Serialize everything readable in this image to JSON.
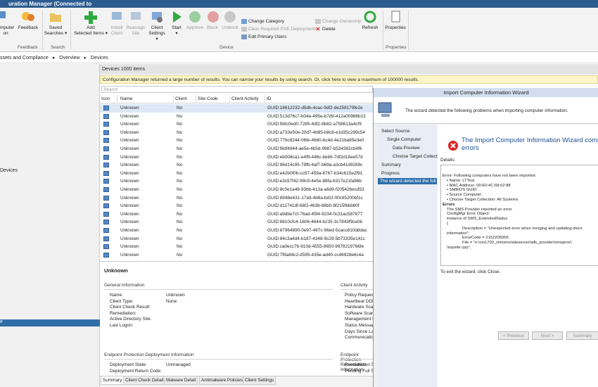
{
  "window": {
    "title": "uration Manager (Connected to"
  },
  "ribbon": {
    "buttons": [
      {
        "label": "Feedback"
      },
      {
        "label": "Saved\nSearches ▾"
      },
      {
        "label": "Add\nSelected Items ▾"
      },
      {
        "label": "Install\nClient"
      },
      {
        "label": "Reassign\nSite"
      },
      {
        "label": "Client\nSettings ▾"
      },
      {
        "label": "Start\n▾"
      },
      {
        "label": "Approve"
      },
      {
        "label": "Block"
      },
      {
        "label": "Unblock"
      },
      {
        "label": "Refresh"
      },
      {
        "label": "Properties"
      }
    ],
    "left_cut": {
      "line1": "mputer",
      "line2": "on"
    },
    "small_items": [
      {
        "label": "Change Category",
        "disabled": false
      },
      {
        "label": "Clear Required PXE Deployments",
        "disabled": true
      },
      {
        "label": "Edit Primary Users",
        "disabled": false
      },
      {
        "label": "Change Ownership",
        "disabled": true
      },
      {
        "label": "Delete",
        "disabled": false
      }
    ],
    "groups": [
      "Feedback",
      "Search",
      "Device",
      "Properties"
    ]
  },
  "address": {
    "parts": [
      "ssets and Compliance",
      "▸",
      "Overview",
      "▸",
      "Devices"
    ]
  },
  "left_pane": {
    "devices_label": "Devices",
    "bottom_label": "e"
  },
  "devices": {
    "header": "Devices 1000 items",
    "info": "Configuration Manager returned a large number of results. You can narrow your results by using search.  Or, click here to view a maximum of 100000 results.",
    "search_placeholder": "Search",
    "columns": [
      "Icon",
      "Name",
      "Client",
      "Site Code",
      "Client Activity",
      "ID"
    ],
    "rows": [
      {
        "name": "Unknown",
        "client": "No",
        "id": "GUID:18612232-d5db-4cac-9df2-de258179fe2e"
      },
      {
        "name": "Unknown",
        "client": "No",
        "id": "GUID:513d76c7-b04e-495e-b7d9-412a00988b13"
      },
      {
        "name": "Unknown",
        "client": "No",
        "id": "GUID:fb8c0ed0-7285-4df2-8b82-a758613a4cf9"
      },
      {
        "name": "Unknown",
        "client": "No",
        "id": "GUID:a733e50e-20d7-4b85-b8c8-e1d35c299c54"
      },
      {
        "name": "Unknown",
        "client": "No",
        "id": "GUID:77bc8244-06fe-4660-bc4d-4e21ba95e3e0"
      },
      {
        "name": "Unknown",
        "client": "No",
        "id": "GUID:f8df4944-ae5e-4b5d-9987-b534382cb4f6"
      },
      {
        "name": "Unknown",
        "client": "No",
        "id": "GUID:eb008ca1-e4f9-446c-beb6-7df2d18ee57d"
      },
      {
        "name": "Unknown",
        "client": "No",
        "id": "GUID:96d14c95-79fb-4af7-b69a-a3cb41d9269c"
      },
      {
        "name": "Unknown",
        "client": "No",
        "id": "GUID:e42b0f0b-cc97-459a-8767-b34c615e2f91"
      },
      {
        "name": "Unknown",
        "client": "No",
        "id": "GUID:e3c97f42-99c9-4e5e-88fa-6317e21fa96b"
      },
      {
        "name": "Unknown",
        "client": "No",
        "id": "GUID:8c0e1a48-93bb-413a-a6d9-f205426ecd53"
      },
      {
        "name": "Unknown",
        "client": "No",
        "id": "GUID:8948e431-17a9-4b6a-bd1f-00c65200bf1c"
      },
      {
        "name": "Unknown",
        "client": "No",
        "id": "GUID:d11741df-66f2-463b-86b0-8f215f6bb60f"
      },
      {
        "name": "Unknown",
        "client": "No",
        "id": "GUID:a9dbe7cf-76ad-45f4-9234-0c31ac587677"
      },
      {
        "name": "Unknown",
        "client": "No",
        "id": "GUID:8810cfc4-1606-4644-b235-3c7843f9ce0b"
      },
      {
        "name": "Unknown",
        "client": "No",
        "id": "GUID:87964890-0e97-487c-96ed-5cacc810dddac"
      },
      {
        "name": "Unknown",
        "client": "No",
        "id": "GUID:84c3a4d4-b187-4348-9c29-5b73335e141c"
      },
      {
        "name": "Unknown",
        "client": "No",
        "id": "GUID:ca0ecc76-910d-4555-9650-9978219766fe"
      },
      {
        "name": "Unknown",
        "client": "No",
        "id": "GUID:7f8a84c2-d595-435e-ad40-cc46928e6c4a"
      }
    ]
  },
  "details": {
    "title": "Unknown",
    "general_header": "General Information",
    "client_activity_header": "Client Activity",
    "general_fields": [
      {
        "label": "Name:",
        "value": "Unknown"
      },
      {
        "label": "Client Type:",
        "value": "None"
      },
      {
        "label": "Client Check Result:",
        "value": ""
      },
      {
        "label": "Remediation:",
        "value": ""
      },
      {
        "label": "Active Directory Site:",
        "value": ""
      },
      {
        "label": "Last Logon:",
        "value": ""
      }
    ],
    "activity_fields": [
      "Policy Request",
      "Heartbeat DDR",
      "Hardware Scan",
      "Software Scan",
      "Management Point:",
      "Status Message",
      "Days Since Last",
      "Communication:"
    ],
    "ep_deploy_header": "Endpoint Protection Deployment Information",
    "ep_remed_header": "Endpoint Protection Remediation Information",
    "ep_deploy_fields": [
      {
        "label": "Deployment State:",
        "value": "Unmanaged"
      },
      {
        "label": "Deployment Return Code:",
        "value": ""
      }
    ],
    "ep_remed_fields": [
      "Remediation Status:",
      "Pending Full Scan:"
    ]
  },
  "tabs": [
    "Summary",
    "Client Check Detail",
    "Malware Detail",
    "Antimalware Policies",
    "Client Settings"
  ],
  "wizard": {
    "title": "Import Computer Information Wizard",
    "header_text": "The wizard detected the following problems when importing computer information.",
    "nav": [
      "Select Source",
      "Single Computer",
      "Data Preview",
      "Choose Target Collect",
      "Summary",
      "Progress",
      "The wizard detected the foll"
    ],
    "error_title": "The Import Computer Information Wizard completed",
    "error_title2": "errors",
    "details_label": "Details:",
    "details_lines": [
      "Error: Following computers have not been imported",
      "• Name: LTTest",
      "• MAC Address: 00:E0:4C:68:02:88",
      "• SMBIOS GUID:",
      "• Source Computer:",
      "• Choose Target Collection: All Systems",
      "Errors",
      "The SMS Provider reported an error.",
      "ConfigMgr Error Object:",
      "instance of SMS_ExtendedStatus",
      "{",
      "Description = \"Unexpected error when merging and updating disco",
      "information\";",
      "ErrorCode = 2152205056;",
      "File = \"e:\\cm1702_rtm\\sms\\siteserver\\sdk_provider\\smsprov\\",
      "\\sspsite.cpp\";"
    ],
    "exit_text": "To exit the wizard, click Close.",
    "buttons": [
      "< Previous",
      "Next >",
      "Summary"
    ]
  }
}
